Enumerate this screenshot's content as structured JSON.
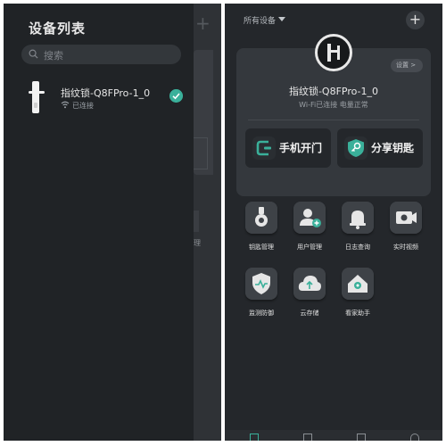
{
  "left_panel": {
    "title": "设备列表",
    "search_placeholder": "搜索",
    "device": {
      "name": "指纹锁-Q8FPro-1_0",
      "status": "已连接"
    }
  },
  "right_panel": {
    "device_selector": "所有设备",
    "card": {
      "setting_label": "设置 >",
      "device_name": "指纹锁-Q8FPro-1_0",
      "status_line": "Wi-Fi已连接 电量正常",
      "actions": [
        {
          "label": "手机开门",
          "icon": "phone-unlock-icon"
        },
        {
          "label": "分享钥匙",
          "icon": "share-key-icon"
        }
      ]
    },
    "features": [
      {
        "label": "钥匙管理",
        "icon": "key-management-icon"
      },
      {
        "label": "用户管理",
        "icon": "user-management-icon"
      },
      {
        "label": "日志查询",
        "icon": "log-query-icon"
      },
      {
        "label": "实时视频",
        "icon": "live-video-icon"
      },
      {
        "label": "监测防御",
        "icon": "monitor-defense-icon"
      },
      {
        "label": "云存储",
        "icon": "cloud-storage-icon"
      },
      {
        "label": "看家助手",
        "icon": "home-guard-icon"
      }
    ]
  },
  "colors": {
    "accent": "#3ab09a",
    "background": "#24272b",
    "card": "#34383d"
  }
}
